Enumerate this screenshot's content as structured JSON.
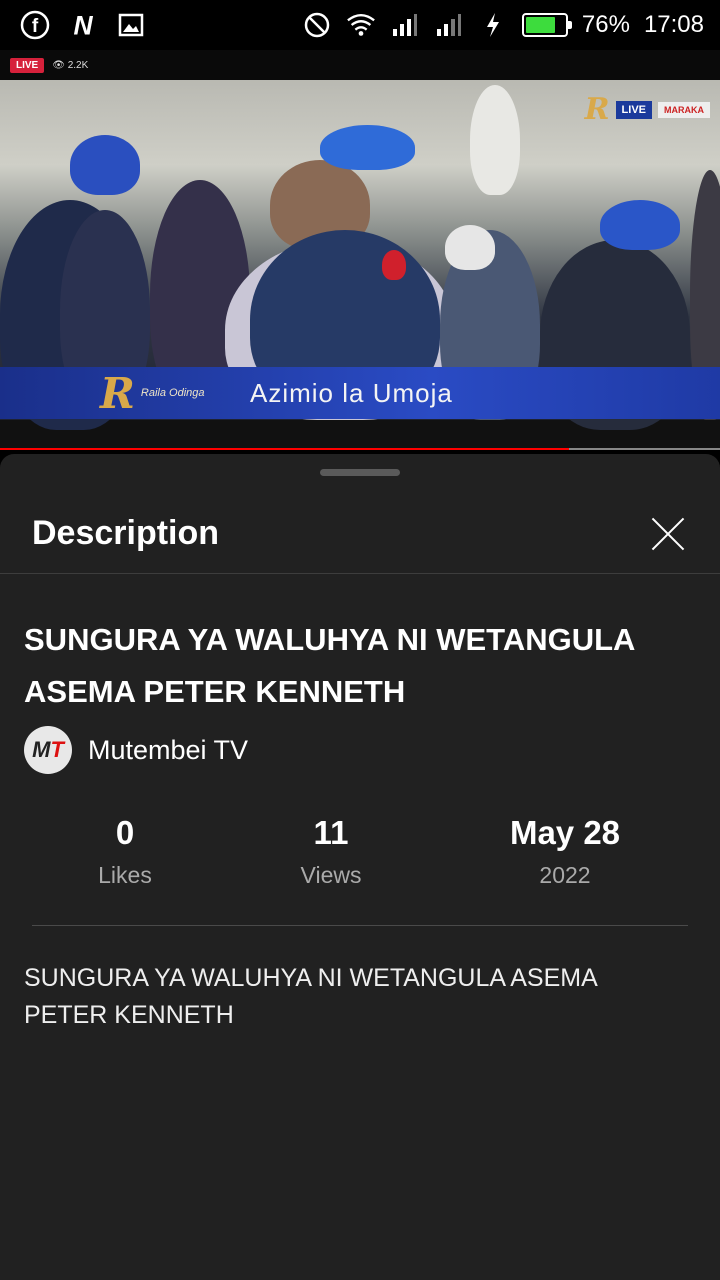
{
  "status_bar": {
    "left_icons": [
      "facebook-icon",
      "netflix-icon",
      "gallery-icon"
    ],
    "right_icons": [
      "do-not-disturb-icon",
      "wifi-icon",
      "signal-icon",
      "signal-icon",
      "charging-icon",
      "battery-icon"
    ],
    "battery_percent": "76%",
    "battery_level": 0.76,
    "time": "17:08"
  },
  "video": {
    "live_label": "LIVE",
    "viewer_count": "2.2K",
    "overlay_title": "Azimio la Umoja",
    "overlay_signature": "Raila Odinga",
    "corner_live": "LIVE",
    "corner_sub": "MARAKA",
    "progress": 0.79,
    "colors": {
      "progress_played": "#ff0000",
      "lower_third": "#2a4bc4"
    }
  },
  "sheet": {
    "title": "Description",
    "close_icon": "close-icon",
    "video_title": "SUNGURA YA WALUHYA NI WETANGULA ASEMA PETER KENNETH",
    "channel": {
      "avatar_text_1": "M",
      "avatar_text_2": "T",
      "name": "Mutembei TV"
    },
    "stats": [
      {
        "value": "0",
        "label": "Likes"
      },
      {
        "value": "11",
        "label": "Views"
      },
      {
        "value": "May 28",
        "label": "2022"
      }
    ],
    "description": "SUNGURA YA WALUHYA NI WETANGULA ASEMA PETER KENNETH"
  }
}
